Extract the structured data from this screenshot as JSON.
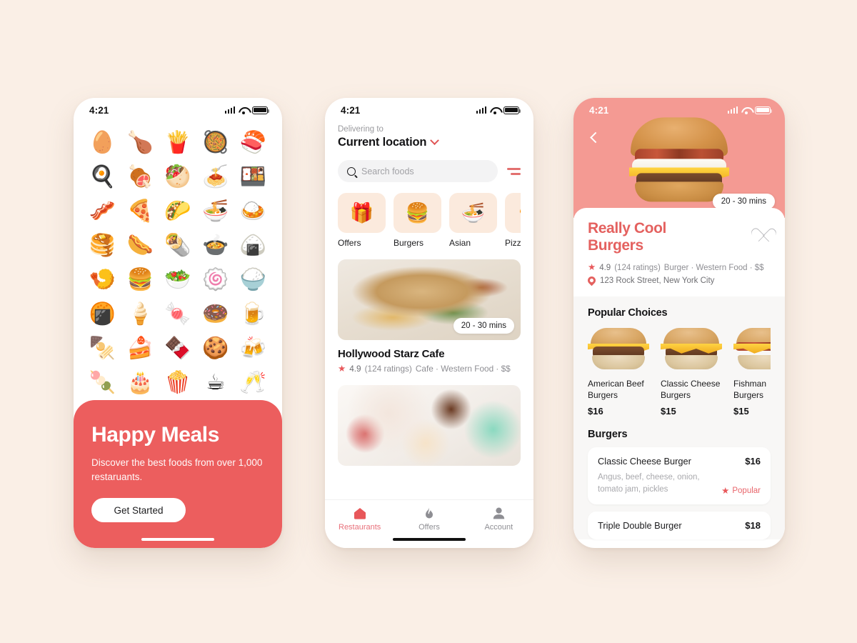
{
  "page": {
    "background_color": "#FAEFE6",
    "accent_red": "#EC5E5E",
    "hero_pink": "#F49A93",
    "category_tile_bg": "#FBEADD"
  },
  "status_bar": {
    "time": "4:21"
  },
  "phone1": {
    "emoji_rows": [
      [
        "🥚",
        "🍗",
        "🍟",
        "🥘",
        "🍣"
      ],
      [
        "🍳",
        "🍖",
        "🥙",
        "🍝",
        "🍱"
      ],
      [
        "🥓",
        "🍕",
        "🌮",
        "🍜",
        "🍛"
      ],
      [
        "🥞",
        "🌭",
        "🌯",
        "🍲",
        "🍙"
      ],
      [
        "🍤",
        "🍔",
        "🥗",
        "🍥",
        "🍚"
      ],
      [
        "🍘",
        "🍦",
        "🍬",
        "🍩",
        "🍺"
      ],
      [
        "🍢",
        "🍰",
        "🍫",
        "🍪",
        "🍻"
      ],
      [
        "🍡",
        "🎂",
        "🍿",
        "☕",
        "🥂"
      ]
    ],
    "promo": {
      "title": "Happy Meals",
      "subtitle": "Discover the best foods from over 1,000 restaruants.",
      "cta_label": "Get Started"
    }
  },
  "phone2": {
    "delivering_label": "Delivering to",
    "location_value": "Current location",
    "search_placeholder": "Search foods",
    "search_value": "",
    "filter_icon": "filter-icon",
    "categories": [
      {
        "label": "Offers",
        "emoji": "🎁"
      },
      {
        "label": "Burgers",
        "emoji": "🍔"
      },
      {
        "label": "Asian",
        "emoji": "🍜"
      },
      {
        "label": "Pizza",
        "emoji": "🍕"
      }
    ],
    "restaurants": [
      {
        "image_style": "img-sandwich",
        "delivery_time": "20 - 30 mins",
        "name": "Hollywood Starz Cafe",
        "rating": "4.9",
        "ratings_count": "(124 ratings)",
        "tags": "Cafe · Western Food · $$"
      },
      {
        "image_style": "img-dessert",
        "delivery_time": "",
        "name": "",
        "rating": "",
        "ratings_count": "",
        "tags": ""
      }
    ],
    "tabs": [
      {
        "label": "Restaurants",
        "icon": "home-icon",
        "glyph": "⌂",
        "active": true
      },
      {
        "label": "Offers",
        "icon": "flame-icon",
        "glyph": "🔥",
        "active": false
      },
      {
        "label": "Account",
        "icon": "person-icon",
        "glyph": "👤",
        "active": false
      }
    ]
  },
  "phone3": {
    "back_icon": "back-chevron-icon",
    "hero_badge": "20 - 30 mins",
    "title": "Really Cool Burgers",
    "favorite_icon": "heart-outline-icon",
    "rating": "4.9",
    "ratings_count": "(124 ratings)",
    "tags": "Burger · Western Food · $$",
    "address": "123 Rock Street, New York City",
    "popular_section_title": "Popular Choices",
    "popular_items": [
      {
        "name": "American Beef Burgers",
        "price": "$16",
        "style": "beef"
      },
      {
        "name": "Classic Cheese Burgers",
        "price": "$15",
        "style": "cheese"
      },
      {
        "name": "Fishman Burgers",
        "price": "$15",
        "style": "fish"
      }
    ],
    "menu_section_title": "Burgers",
    "menu_items": [
      {
        "name": "Classic Cheese Burger",
        "price": "$16",
        "description": "Angus, beef, cheese, onion, tomato jam, pickles",
        "badge": "Popular",
        "badge_icon": "star-icon"
      },
      {
        "name": "Triple Double Burger",
        "price": "$18",
        "description": "",
        "badge": "",
        "badge_icon": ""
      }
    ]
  }
}
